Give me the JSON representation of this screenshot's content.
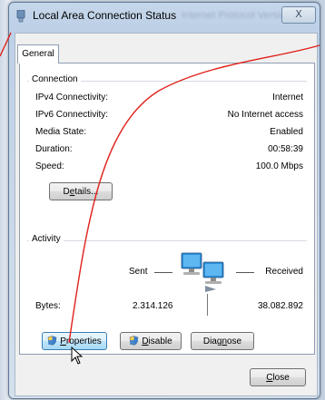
{
  "window": {
    "title": "Local Area Connection Status",
    "background_title": "Internet Protocol Version",
    "close_glyph": "X"
  },
  "tabs": [
    {
      "label": "General"
    }
  ],
  "connection": {
    "heading": "Connection",
    "rows": [
      {
        "label": "IPv4 Connectivity:",
        "value": "Internet"
      },
      {
        "label": "IPv6 Connectivity:",
        "value": "No Internet access"
      },
      {
        "label": "Media State:",
        "value": "Enabled"
      },
      {
        "label": "Duration:",
        "value": "00:58:39"
      },
      {
        "label": "Speed:",
        "value": "100.0 Mbps"
      }
    ],
    "details": {
      "pre": "D",
      "accel": "e",
      "post": "tails..."
    }
  },
  "activity": {
    "heading": "Activity",
    "sent_label": "Sent",
    "received_label": "Received",
    "bytes_label": "Bytes:",
    "bytes_sent": "2.314.126",
    "bytes_received": "38.082.892"
  },
  "buttons": {
    "properties": {
      "accel": "P",
      "post": "roperties"
    },
    "disable": {
      "accel": "D",
      "post": "isable"
    },
    "diagnose": {
      "pre": "Diag",
      "accel": "n",
      "post": "ose"
    },
    "close": {
      "accel": "C",
      "post": "lose"
    }
  },
  "icons": {
    "app": "network-adapter-icon",
    "uac": "uac-shield-icon",
    "activity": "network-computers-icon",
    "cursor": "mouse-pointer-icon"
  },
  "colors": {
    "annotation": "#e0201a",
    "accent": "#3c7fb1"
  }
}
